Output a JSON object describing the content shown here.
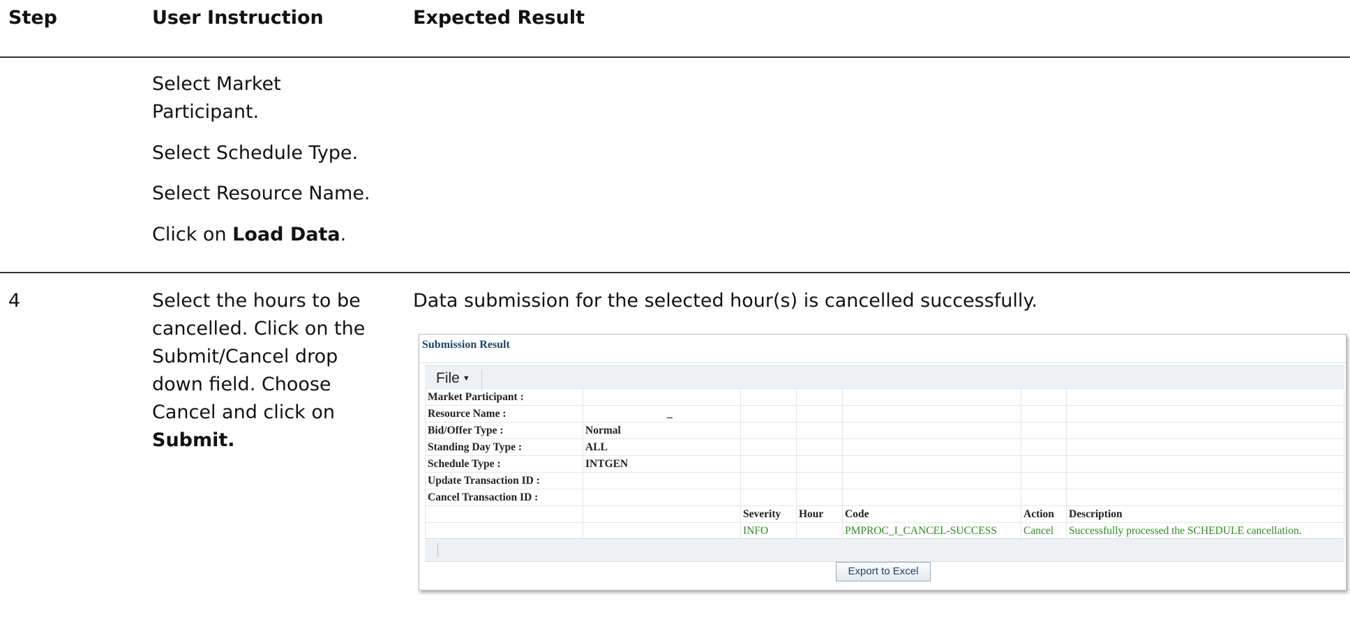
{
  "headers": {
    "step": "Step",
    "instruction": "User Instruction",
    "expected": "Expected Result"
  },
  "row1": {
    "lines": [
      "Select Market",
      "Participant.",
      "Select Schedule Type.",
      "Select Resource Name."
    ],
    "click_prefix": "Click on ",
    "click_bold": "Load Data",
    "click_suffix": "."
  },
  "row2": {
    "step": "4",
    "instruction_lines": [
      "Select the hours to be",
      "cancelled. Click on the",
      "Submit/Cancel drop",
      "down field. Choose",
      "Cancel and click on"
    ],
    "instruction_bold": "Submit.",
    "expected": "Data submission for the selected hour(s) is cancelled successfully."
  },
  "screenshot": {
    "title": "Submission Result",
    "file_menu": "File",
    "labels": {
      "market_participant": "Market Participant :",
      "resource_name": "Resource Name :",
      "bid_offer_type": "Bid/Offer Type :",
      "standing_day_type": "Standing Day Type :",
      "schedule_type": "Schedule Type :",
      "update_txn": "Update Transaction ID :",
      "cancel_txn": "Cancel Transaction ID :"
    },
    "values": {
      "resource_name": "_",
      "bid_offer_type": "Normal",
      "standing_day_type": "ALL",
      "schedule_type": "INTGEN"
    },
    "columns": {
      "severity": "Severity",
      "hour": "Hour",
      "code": "Code",
      "action": "Action",
      "description": "Description"
    },
    "result": {
      "severity": "INFO",
      "hour": "",
      "code": "PMPROC_I_CANCEL-SUCCESS",
      "action": "Cancel",
      "description": "Successfully processed the SCHEDULE cancellation."
    },
    "export_button": "Export to Excel"
  }
}
